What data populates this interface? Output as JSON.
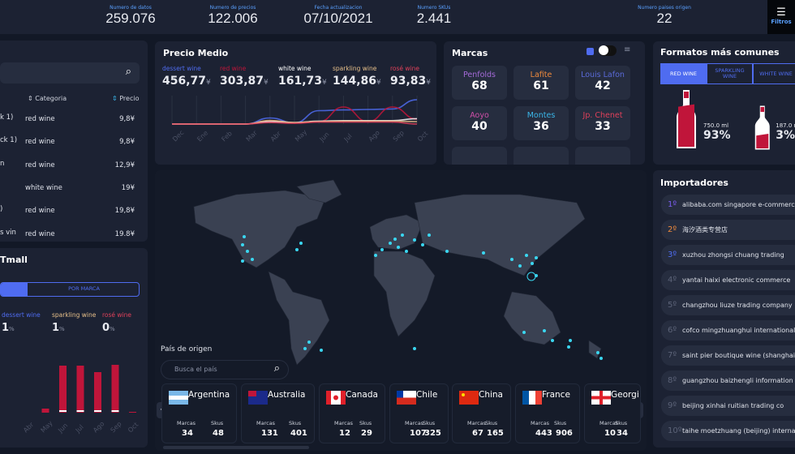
{
  "kpis": [
    {
      "label": "Numero de datos",
      "value": "259.076"
    },
    {
      "label": "Numero de precios",
      "value": "122.006"
    },
    {
      "label": "Fecha actualizacion",
      "value": "07/10/2021"
    },
    {
      "label": "Numero SKUs",
      "value": "2.441"
    },
    {
      "label": "Numero paises origen",
      "value": "22"
    }
  ],
  "filters_label": "Filtros",
  "products": {
    "columns": [
      "Categoria",
      "Precio"
    ],
    "rows": [
      {
        "name": "k 1)",
        "category": "red wine",
        "price": "9,8¥"
      },
      {
        "name": "ck 1)",
        "category": "red wine",
        "price": "9,8¥"
      },
      {
        "name": "n",
        "category": "red wine",
        "price": "12,9¥"
      },
      {
        "name": "",
        "category": "white wine",
        "price": "19¥"
      },
      {
        "name": ")",
        "category": "red wine",
        "price": "19,8¥"
      },
      {
        "name": "s vin",
        "category": "red wine",
        "price": "19.8¥"
      }
    ]
  },
  "tmall": {
    "title": "Tmall",
    "tab_active": "",
    "tab_other": "POR MARCA",
    "stats": [
      {
        "label": "dessert wine",
        "value": "1",
        "unit": "%",
        "color": "#4f6cf0"
      },
      {
        "label": "sparkling wine",
        "value": "1",
        "unit": "%",
        "color": "#e7c08a"
      },
      {
        "label": "rosé wine",
        "value": "0",
        "unit": "%",
        "color": "#e0405a"
      }
    ]
  },
  "precio_medio": {
    "title": "Precio Medio",
    "stats": [
      {
        "label": "dessert wine",
        "value": "456,77",
        "unit": "¥",
        "color": "#4f6cf0"
      },
      {
        "label": "red wine",
        "value": "303,87",
        "unit": "¥",
        "color": "#c0153a"
      },
      {
        "label": "white wine",
        "value": "161,73",
        "unit": "¥",
        "color": "#ffffff"
      },
      {
        "label": "sparkling wine",
        "value": "144,86",
        "unit": "¥",
        "color": "#e7c08a"
      },
      {
        "label": "rosé wine",
        "value": "93,83",
        "unit": "¥",
        "color": "#e0405a"
      }
    ]
  },
  "marcas": {
    "title": "Marcas",
    "brands": [
      {
        "name": "Penfolds",
        "count": "68",
        "color": "#a46ad8"
      },
      {
        "name": "Lafite",
        "count": "61",
        "color": "#f08a3c"
      },
      {
        "name": "Louis Lafon",
        "count": "42",
        "color": "#5a6ad8"
      },
      {
        "name": "Aoyo",
        "count": "40",
        "color": "#d04fa8"
      },
      {
        "name": "Montes",
        "count": "36",
        "color": "#3ab6e8"
      },
      {
        "name": "Jp. Chenet",
        "count": "33",
        "color": "#e0405a"
      }
    ]
  },
  "formatos": {
    "title": "Formatos más comunes",
    "tabs": [
      "RED WINE",
      "SPARKLING WINE",
      "WHITE WINE"
    ],
    "active_tab": "RED WINE",
    "items": [
      {
        "size": "750.0 ml",
        "pct": "93%",
        "fill": 0.93
      },
      {
        "size": "187.0 ml",
        "pct": "3%",
        "fill": 0.5
      }
    ]
  },
  "importadores": {
    "title": "Importadores",
    "items": [
      {
        "rank": "1º",
        "name": "alibaba.com singapore e-commerce",
        "color": "#7b5cf0"
      },
      {
        "rank": "2º",
        "name": "海汐酒类专营店",
        "color": "#f08a3c"
      },
      {
        "rank": "3º",
        "name": "xuzhou zhongsi chuang trading",
        "color": "#4f6cf0"
      },
      {
        "rank": "4º",
        "name": "yantai haixi electronic commerce"
      },
      {
        "rank": "5º",
        "name": "changzhou liuze trading company"
      },
      {
        "rank": "6º",
        "name": "cofco mingzhuanghui international"
      },
      {
        "rank": "7º",
        "name": "saint pier boutique wine (shanghai)"
      },
      {
        "rank": "8º",
        "name": "guangzhou baizhengli information"
      },
      {
        "rank": "9º",
        "name": "beijing xinhai ruitian trading co"
      },
      {
        "rank": "10º",
        "name": "taihe moetzhuang (beijing) international"
      }
    ]
  },
  "origen": {
    "title": "País de origen",
    "search_placeholder": "Busca el país",
    "marcas_label": "Marcas",
    "skus_label": "Skus",
    "countries": [
      {
        "name": "Argentina",
        "marcas": "34",
        "skus": "48",
        "flag": "ar"
      },
      {
        "name": "Australia",
        "marcas": "131",
        "skus": "401",
        "flag": "au"
      },
      {
        "name": "Canada",
        "marcas": "12",
        "skus": "29",
        "flag": "ca"
      },
      {
        "name": "Chile",
        "marcas": "107",
        "skus": "325",
        "flag": "cl"
      },
      {
        "name": "China",
        "marcas": "67",
        "skus": "165",
        "flag": "cn"
      },
      {
        "name": "France",
        "marcas": "443",
        "skus": "906",
        "flag": "fr"
      },
      {
        "name": "Georgi",
        "marcas": "10",
        "skus": "34",
        "flag": "ge"
      }
    ]
  },
  "chart_data": [
    {
      "type": "line",
      "months": [
        "Dec",
        "Ene",
        "Feb",
        "Mar",
        "Abr",
        "May",
        "Jun",
        "Jul",
        "Ago",
        "Sep",
        "Oct"
      ],
      "series": [
        {
          "name": "dessert wine",
          "color": "#4f6cf0",
          "values": [
            0,
            0,
            0,
            0,
            25,
            5,
            55,
            58,
            60,
            62,
            100
          ]
        },
        {
          "name": "red wine",
          "color": "#c0153a",
          "values": [
            0,
            0,
            0,
            0,
            12,
            5,
            10,
            70,
            10,
            70,
            20
          ]
        },
        {
          "name": "white wine",
          "color": "#ffffff",
          "values": [
            0,
            0,
            0,
            0,
            10,
            6,
            12,
            14,
            14,
            14,
            22
          ]
        },
        {
          "name": "sparkling wine",
          "color": "#e7c08a",
          "values": [
            0,
            0,
            0,
            0,
            15,
            6,
            10,
            12,
            12,
            12,
            10
          ]
        },
        {
          "name": "rosé wine",
          "color": "#e0405a",
          "values": [
            0,
            0,
            0,
            0,
            6,
            3,
            8,
            8,
            8,
            8,
            0
          ]
        }
      ]
    },
    {
      "type": "bar",
      "categories": [
        "Abr",
        "May",
        "Jun",
        "Jul",
        "Ago",
        "Sep",
        "Oct"
      ],
      "values": [
        0,
        5,
        58,
        58,
        50,
        59,
        1
      ]
    }
  ]
}
